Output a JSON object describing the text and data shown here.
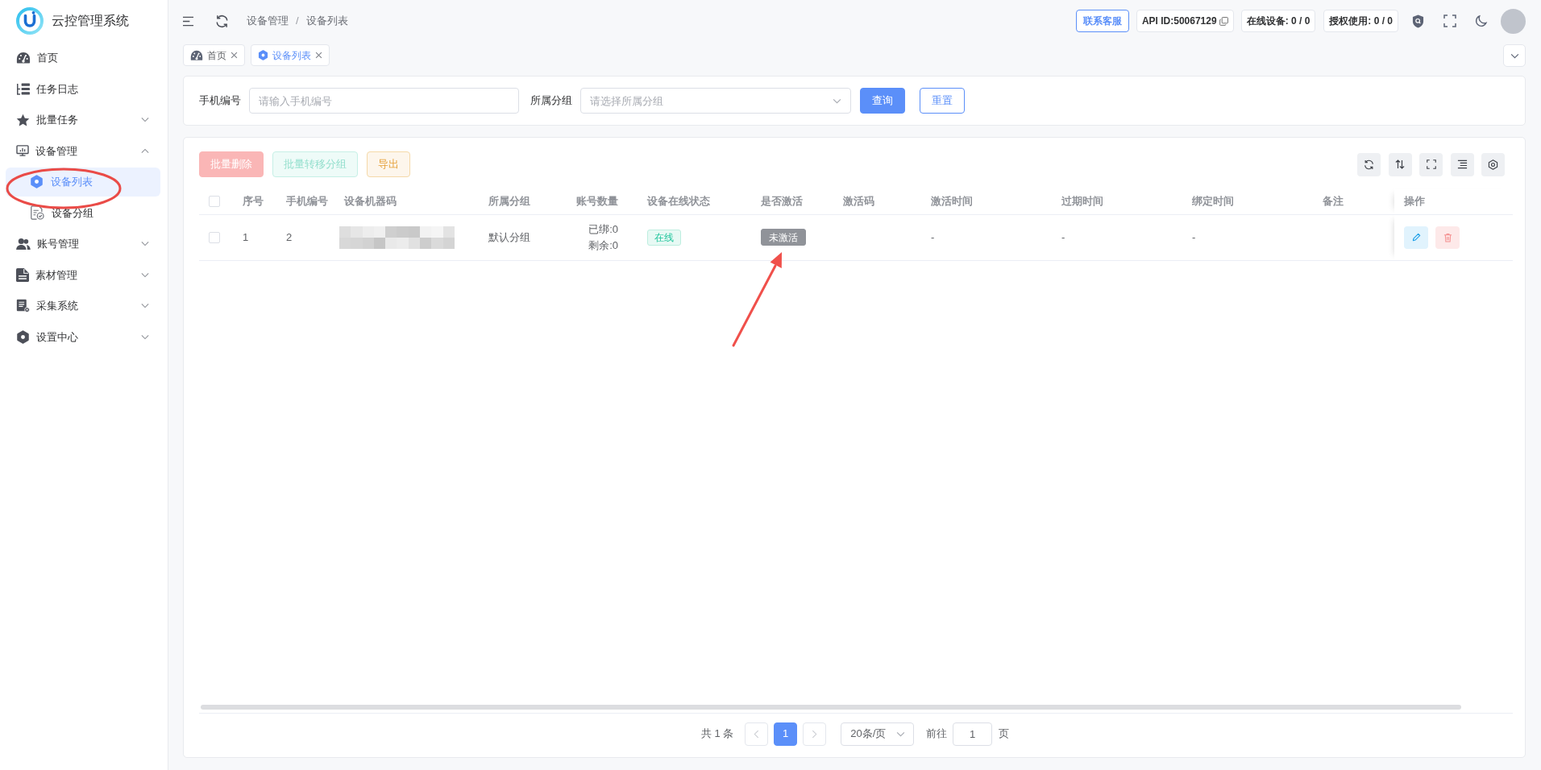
{
  "sidebar": {
    "title": "云控管理系统",
    "items": [
      {
        "label": "首页",
        "kind": "link",
        "selected": false
      },
      {
        "label": "任务日志",
        "kind": "link",
        "selected": false
      },
      {
        "label": "批量任务",
        "kind": "submenu",
        "selected": false,
        "expanded": false
      },
      {
        "label": "设备管理",
        "kind": "submenu",
        "selected": false,
        "expanded": true,
        "children": [
          {
            "label": "设备列表",
            "selected": true
          },
          {
            "label": "设备分组",
            "selected": false
          }
        ]
      },
      {
        "label": "账号管理",
        "kind": "submenu",
        "selected": false,
        "expanded": false
      },
      {
        "label": "素材管理",
        "kind": "submenu",
        "selected": false,
        "expanded": false
      },
      {
        "label": "采集系统",
        "kind": "submenu",
        "selected": false,
        "expanded": false
      },
      {
        "label": "设置中心",
        "kind": "submenu",
        "selected": false,
        "expanded": false
      }
    ]
  },
  "header": {
    "breadcrumb": [
      "设备管理",
      "设备列表"
    ],
    "separator": "/",
    "contact_button": "联系客服",
    "chips": [
      {
        "label": "API ID:50067129",
        "copyable": true
      },
      {
        "label": "在线设备: 0 / 0",
        "copyable": false
      },
      {
        "label": "授权使用: 0 / 0",
        "copyable": false
      }
    ]
  },
  "tabs": [
    {
      "label": "首页",
      "selected": false
    },
    {
      "label": "设备列表",
      "selected": true
    }
  ],
  "filters": {
    "fields": [
      {
        "label": "手机编号",
        "kind": "input",
        "placeholder": "请输入手机编号"
      },
      {
        "label": "所属分组",
        "kind": "select",
        "placeholder": "请选择所属分组"
      }
    ],
    "buttons": [
      {
        "label": "查询",
        "kind": "primary"
      },
      {
        "label": "重置",
        "kind": "outline"
      }
    ]
  },
  "toolbar": {
    "buttons": [
      {
        "label": "批量删除",
        "kind": "danger",
        "disabled": true
      },
      {
        "label": "批量转移分组",
        "kind": "success",
        "disabled": true
      },
      {
        "label": "导出",
        "kind": "warning",
        "disabled": false
      }
    ]
  },
  "table": {
    "select_all_checked": false,
    "columns": [
      "序号",
      "手机编号",
      "设备机器码",
      "所属分组",
      "账号数量",
      "设备在线状态",
      "是否激活",
      "激活码",
      "激活时间",
      "过期时间",
      "绑定时间",
      "备注",
      "操作"
    ],
    "rows": [
      {
        "checked": false,
        "index": "1",
        "phone": "2",
        "group": "默认分组",
        "accounts": [
          "已绑:0",
          "剩余:0"
        ],
        "online": {
          "label": "在线",
          "on": true
        },
        "activation": {
          "label": "未激活",
          "activated": false
        },
        "activated_at": "-",
        "expires_at": "-",
        "bound_at": "-"
      }
    ]
  },
  "pagination": {
    "total": "共 1 条",
    "prev_disabled": true,
    "pages": [
      {
        "label": "1",
        "selected": true
      }
    ],
    "next_disabled": true,
    "page_size": "20条/页",
    "goto_label": "前往",
    "goto_value": "1",
    "goto_suffix": "页"
  }
}
